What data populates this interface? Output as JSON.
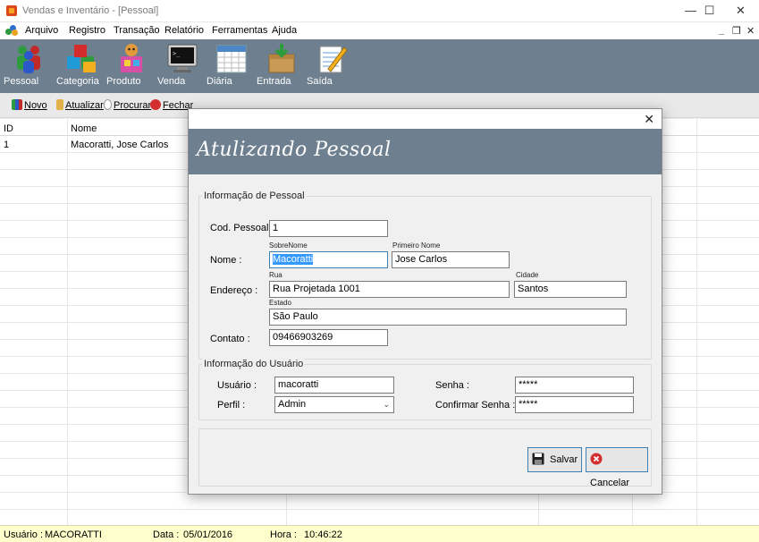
{
  "window": {
    "title": "Vendas e Inventário - [Pessoal]",
    "minimize": "—",
    "maximize": "☐",
    "close": "✕"
  },
  "menu": {
    "items": [
      "Arquivo",
      "Registro",
      "Transação",
      "Relatório",
      "Ferramentas",
      "Ajuda"
    ],
    "mdi_minimize": "_",
    "mdi_restore": "❐",
    "mdi_close": "✕"
  },
  "toolbar": {
    "buttons": [
      {
        "label": "Pessoal",
        "icon": "people-icon"
      },
      {
        "label": "Categoria",
        "icon": "cubes-icon"
      },
      {
        "label": "Produto",
        "icon": "toys-icon"
      },
      {
        "label": "Venda",
        "icon": "monitor-icon"
      },
      {
        "label": "Diária",
        "icon": "calendar-icon"
      },
      {
        "label": "Entrada",
        "icon": "box-in-icon"
      },
      {
        "label": "Saída",
        "icon": "notepad-icon"
      }
    ]
  },
  "actions": {
    "novo": "Novo",
    "atualizar": "Atualizar",
    "procurar": "Procurar",
    "fechar": "Fechar"
  },
  "grid": {
    "columns": [
      "ID",
      "Nome"
    ],
    "rows": [
      {
        "id": "1",
        "nome": "Macoratti, Jose Carlos"
      }
    ]
  },
  "status": {
    "usuario_label": "Usuário :",
    "usuario_value": "MACORATTI",
    "data_label": "Data :",
    "data_value": "05/01/2016",
    "hora_label": "Hora :",
    "hora_value": "10:46:22"
  },
  "dialog": {
    "close": "✕",
    "banner_title": "Atulizando Pessoal",
    "group_pessoal": "Informação de Pessoal",
    "cod_label": "Cod. Pessoal :",
    "cod_value": "1",
    "nome_label": "Nome :",
    "sobrenome_caption": "SobreNome",
    "sobrenome_value": "Macoratti",
    "primeiro_caption": "Primeiro Nome",
    "primeiro_value": "Jose Carlos",
    "endereco_label": "Endereço :",
    "rua_caption": "Rua",
    "rua_value": "Rua Projetada 1001",
    "cidade_caption": "Cidade",
    "cidade_value": "Santos",
    "estado_caption": "Estado",
    "estado_value": "São Paulo",
    "contato_label": "Contato :",
    "contato_value": "09466903269",
    "group_usuario": "Informação do Usuário",
    "usuario_label": "Usuário :",
    "usuario_value": "macoratti",
    "perfil_label": "Perfil :",
    "perfil_value": "Admin",
    "senha_label": "Senha :",
    "senha_value": "*****",
    "confirmar_label": "Confirmar Senha :",
    "confirmar_value": "*****",
    "salvar": "Salvar",
    "cancelar": "Cancelar"
  }
}
